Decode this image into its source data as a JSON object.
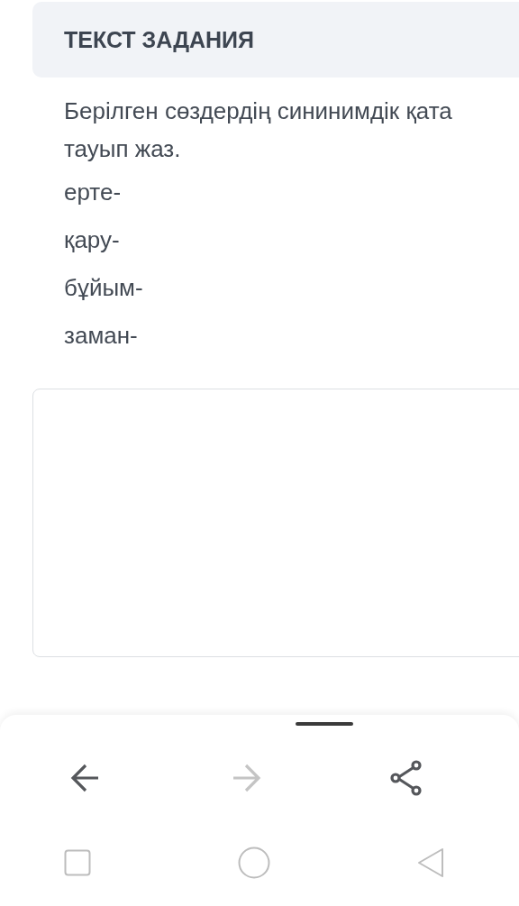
{
  "task_header": {
    "title": "ТЕКСТ ЗАДАНИЯ"
  },
  "task_text": {
    "lines": [
      "Берілген сөздердің сининимдік қата",
      "тауып жаз."
    ],
    "words": [
      "ерте-",
      "қару-",
      "бұйым-",
      "заман-"
    ]
  },
  "answer_box": {
    "kind": "empty"
  },
  "browser_toolbar": [
    {
      "kind": "back",
      "disabled": false
    },
    {
      "kind": "forward",
      "disabled": true
    },
    {
      "kind": "share",
      "disabled": false
    }
  ],
  "system_nav": [
    {
      "kind": "recents"
    },
    {
      "kind": "home"
    },
    {
      "kind": "back"
    }
  ]
}
